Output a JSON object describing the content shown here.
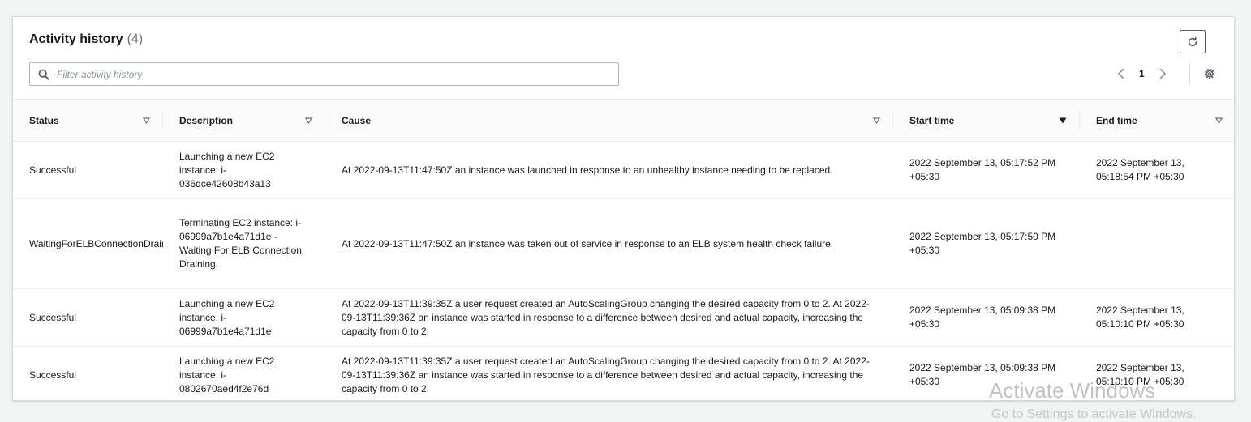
{
  "activity": {
    "title": "Activity history",
    "count": "(4)",
    "search_placeholder": "Filter activity history",
    "page_number": "1"
  },
  "icons": {
    "refresh": "refresh-icon",
    "search": "search-icon",
    "prev": "chevron-left-icon",
    "next": "chevron-right-icon",
    "settings": "gear-icon",
    "sort": "caret-down-icon"
  },
  "colors": {
    "status_success": "#1d8102",
    "border": "#d5dbdb"
  },
  "table": {
    "columns": [
      "Status",
      "Description",
      "Cause",
      "Start time",
      "End time"
    ],
    "sorted_column": "Start time",
    "rows": [
      {
        "status": "Successful",
        "description": "Launching a new EC2 instance: i-036dce42608b43a13",
        "cause": "At 2022-09-13T11:47:50Z an instance was launched in response to an unhealthy instance needing to be replaced.",
        "start": "2022 September 13, 05:17:52 PM +05:30",
        "end": "2022 September 13, 05:18:54 PM +05:30"
      },
      {
        "status": "WaitingForELBConnectionDraining",
        "description": "Terminating EC2 instance: i-06999a7b1e4a71d1e - Waiting For ELB Connection Draining.",
        "cause": "At 2022-09-13T11:47:50Z an instance was taken out of service in response to an ELB system health check failure.",
        "start": "2022 September 13, 05:17:50 PM +05:30",
        "end": ""
      },
      {
        "status": "Successful",
        "description": "Launching a new EC2 instance: i-06999a7b1e4a71d1e",
        "cause": "At 2022-09-13T11:39:35Z a user request created an AutoScalingGroup changing the desired capacity from 0 to 2. At 2022-09-13T11:39:36Z an instance was started in response to a difference between desired and actual capacity, increasing the capacity from 0 to 2.",
        "start": "2022 September 13, 05:09:38 PM +05:30",
        "end": "2022 September 13, 05:10:10 PM +05:30"
      },
      {
        "status": "Successful",
        "description": "Launching a new EC2 instance: i-0802670aed4f2e76d",
        "cause": "At 2022-09-13T11:39:35Z a user request created an AutoScalingGroup changing the desired capacity from 0 to 2. At 2022-09-13T11:39:36Z an instance was started in response to a difference between desired and actual capacity, increasing the capacity from 0 to 2.",
        "start": "2022 September 13, 05:09:38 PM +05:30",
        "end": "2022 September 13, 05:10:10 PM +05:30"
      }
    ]
  },
  "watermark": {
    "line1": "Activate Windows",
    "line2": "Go to Settings to activate Windows."
  }
}
